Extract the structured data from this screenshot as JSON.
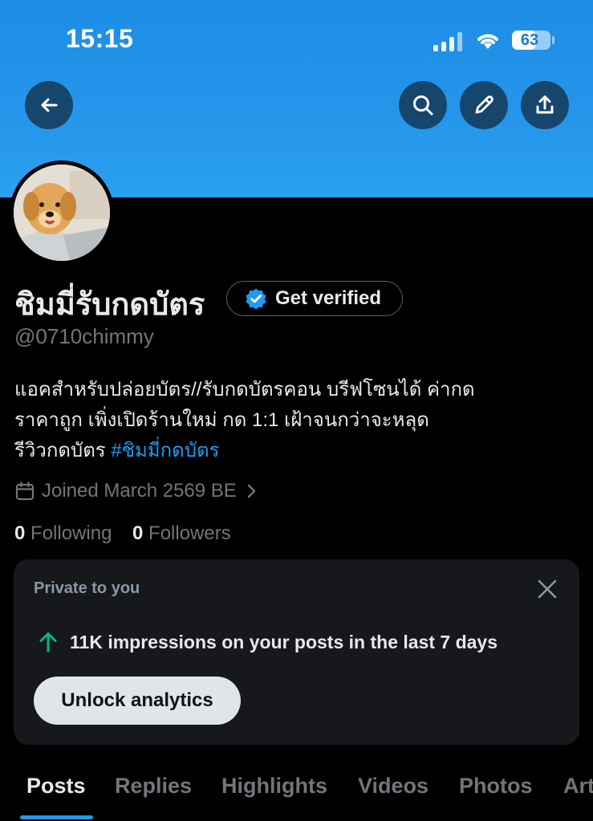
{
  "status_bar": {
    "time": "15:15",
    "battery": "63",
    "battery_level": 0.63
  },
  "profile": {
    "name": "ชิมมี่รับกดบัตร",
    "get_verified_label": "Get verified",
    "handle": "@0710chimmy",
    "bio_line1": "แอคสำหรับปล่อยบัตร//รับกดบัตรคอน บรีฟโซนได้ ค่ากด",
    "bio_line2": "ราคาถูก เพิ่งเปิดร้านใหม่ กด 1:1 เฝ้าจนกว่าจะหลุด",
    "bio_line3_prefix": "รีวิวกดบัตร ",
    "bio_hashtag": "#ชิมมี่กดบัตร",
    "joined": "Joined March 2569 BE",
    "following_count": "0",
    "following_label": "Following",
    "followers_count": "0",
    "followers_label": "Followers"
  },
  "analytics_card": {
    "title": "Private to you",
    "stat": "11K impressions on your posts in the last 7 days",
    "button": "Unlock analytics"
  },
  "tabs": [
    "Posts",
    "Replies",
    "Highlights",
    "Videos",
    "Photos",
    "Art"
  ],
  "icons": {
    "back": "arrow-left-icon",
    "search": "search-icon",
    "edit": "pencil-icon",
    "share": "share-icon",
    "verified": "verified-badge-icon",
    "calendar": "calendar-icon",
    "close": "close-icon",
    "trend": "arrow-up-icon"
  },
  "colors": {
    "accent": "#1d9bf0",
    "banner": "#2596ea",
    "trend_up": "#00ba7c"
  }
}
